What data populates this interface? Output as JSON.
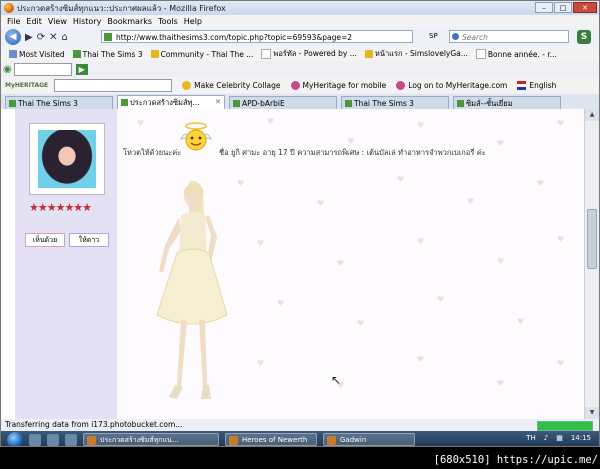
{
  "window": {
    "title": "ประกวดสร้างซิมส์ทุกแนว::ประกาศผลแล้ว - Mozilla Firefox",
    "minimize": "–",
    "maximize": "□",
    "close": "✕"
  },
  "menu": [
    "File",
    "Edit",
    "View",
    "History",
    "Bookmarks",
    "Tools",
    "Help"
  ],
  "nav": {
    "back": "◀",
    "forward": "▶",
    "url": "http://www.thaithesims3.com/topic.php?topic=69593&page=2",
    "search_engine": "SP",
    "search_placeholder": "Search"
  },
  "bookmarks": [
    "Most Visited",
    "Thai The Sims 3",
    "Community - Thai The ...",
    "พอร์ทัล - Powered by ...",
    "หน้าแรก - SimslovelyGa...",
    "Bonne année. - r..."
  ],
  "toolbar3": {
    "logo": "MyHERITAGE",
    "items": [
      "Make Celebrity Collage",
      "MyHeritage for mobile",
      "Log on to MyHeritage.com",
      "English"
    ]
  },
  "tabs": [
    {
      "label": "Thai The Sims 3",
      "active": false
    },
    {
      "label": "ประกวดสร้างซิมส์ทุ...",
      "active": true
    },
    {
      "label": "APD-bArbiE",
      "active": false
    },
    {
      "label": "Thai The Sims 3",
      "active": false
    },
    {
      "label": "ซิมส์--ชั้นเยี่ยม",
      "active": false
    }
  ],
  "post": {
    "label": "โหวตให้ด้วยนะค่ะ",
    "text": "ชื่อ ยูกิ ศามะ อายุ 17 ปี ความสามารถพิเศษ : เต้นบัลเล่ ทำอาหารจำพวกเบเกอรี่ ค่ะ",
    "like_button": "เห็นด้วย",
    "thanks_button": "ให้ดาว",
    "rating": "★★★★★★★"
  },
  "status": {
    "text": "Transferring data from i173.photobucket.com...",
    "progress": 1.0
  },
  "taskbar": {
    "items": [
      "ประกวดสร้างซิมส์ทุกแน...",
      "Heroes of Newerth",
      "Gadwin"
    ],
    "lang": "TH",
    "time": "14:15"
  },
  "watermark": "[680x510] https://upic.me/",
  "colors": {
    "sidebar": "#e3e1f3",
    "accent": "#2a5db0",
    "progress": "#2fc04a"
  }
}
